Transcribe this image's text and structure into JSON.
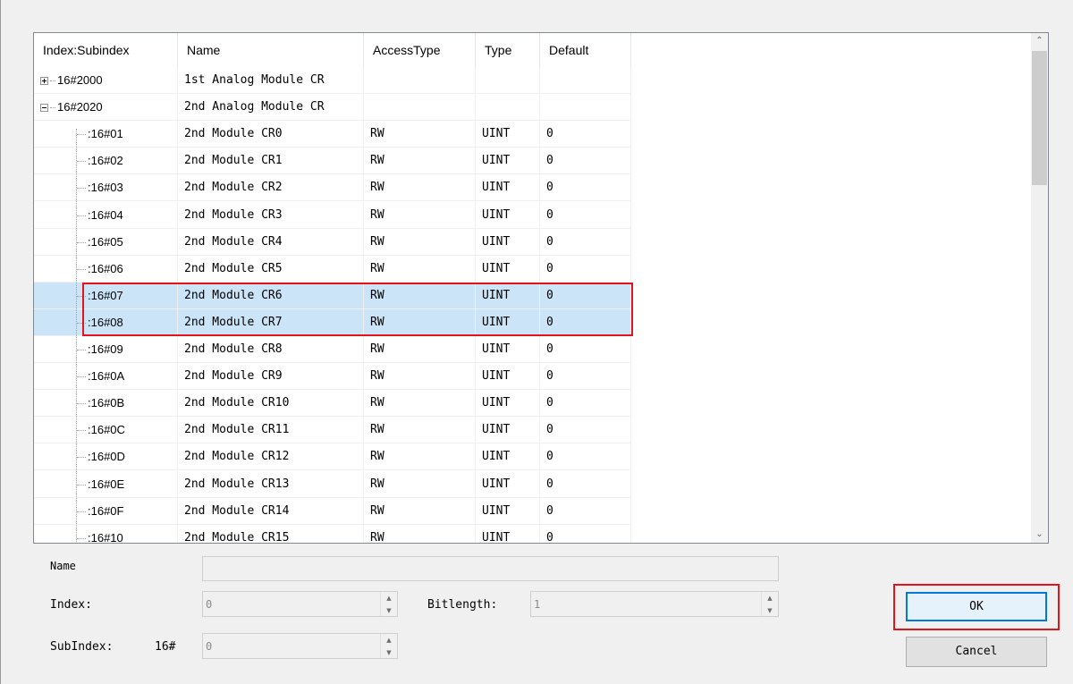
{
  "table": {
    "headers": [
      "Index:Subindex",
      "Name",
      "AccessType",
      "Type",
      "Default"
    ],
    "rows": [
      {
        "index": "16#2000",
        "name": "1st Analog Module CR",
        "access": "",
        "type": "",
        "default": "",
        "kind": "group",
        "expanded": false
      },
      {
        "index": "16#2020",
        "name": "2nd Analog Module CR",
        "access": "",
        "type": "",
        "default": "",
        "kind": "group",
        "expanded": true
      },
      {
        "index": ":16#01",
        "name": "2nd Module CR0",
        "access": "RW",
        "type": "UINT",
        "default": "0",
        "kind": "sub"
      },
      {
        "index": ":16#02",
        "name": "2nd Module CR1",
        "access": "RW",
        "type": "UINT",
        "default": "0",
        "kind": "sub"
      },
      {
        "index": ":16#03",
        "name": "2nd Module CR2",
        "access": "RW",
        "type": "UINT",
        "default": "0",
        "kind": "sub"
      },
      {
        "index": ":16#04",
        "name": "2nd Module CR3",
        "access": "RW",
        "type": "UINT",
        "default": "0",
        "kind": "sub"
      },
      {
        "index": ":16#05",
        "name": "2nd Module CR4",
        "access": "RW",
        "type": "UINT",
        "default": "0",
        "kind": "sub"
      },
      {
        "index": ":16#06",
        "name": "2nd Module CR5",
        "access": "RW",
        "type": "UINT",
        "default": "0",
        "kind": "sub"
      },
      {
        "index": ":16#07",
        "name": "2nd Module CR6",
        "access": "RW",
        "type": "UINT",
        "default": "0",
        "kind": "sub",
        "selected": true
      },
      {
        "index": ":16#08",
        "name": "2nd Module CR7",
        "access": "RW",
        "type": "UINT",
        "default": "0",
        "kind": "sub",
        "selected": true
      },
      {
        "index": ":16#09",
        "name": "2nd Module CR8",
        "access": "RW",
        "type": "UINT",
        "default": "0",
        "kind": "sub"
      },
      {
        "index": ":16#0A",
        "name": "2nd Module CR9",
        "access": "RW",
        "type": "UINT",
        "default": "0",
        "kind": "sub"
      },
      {
        "index": ":16#0B",
        "name": "2nd Module CR10",
        "access": "RW",
        "type": "UINT",
        "default": "0",
        "kind": "sub"
      },
      {
        "index": ":16#0C",
        "name": "2nd Module CR11",
        "access": "RW",
        "type": "UINT",
        "default": "0",
        "kind": "sub"
      },
      {
        "index": ":16#0D",
        "name": "2nd Module CR12",
        "access": "RW",
        "type": "UINT",
        "default": "0",
        "kind": "sub"
      },
      {
        "index": ":16#0E",
        "name": "2nd Module CR13",
        "access": "RW",
        "type": "UINT",
        "default": "0",
        "kind": "sub"
      },
      {
        "index": ":16#0F",
        "name": "2nd Module CR14",
        "access": "RW",
        "type": "UINT",
        "default": "0",
        "kind": "sub"
      },
      {
        "index": ":16#10",
        "name": "2nd Module CR15",
        "access": "RW",
        "type": "UINT",
        "default": "0",
        "kind": "sub"
      }
    ]
  },
  "form": {
    "name_label": "Name",
    "name_value": "",
    "index_label": "Index:",
    "index_value": "0",
    "bitlength_label": "Bitlength:",
    "bitlength_value": "1",
    "subindex_label": "SubIndex:",
    "subindex_prefix": "16#",
    "subindex_value": "0"
  },
  "buttons": {
    "ok": "OK",
    "cancel": "Cancel"
  },
  "colors": {
    "selection": "#cce4f7",
    "highlight_annotation": "#e0141a",
    "default_button_border": "#0078d7"
  }
}
